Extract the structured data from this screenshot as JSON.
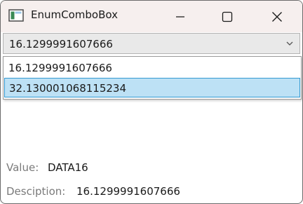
{
  "window": {
    "title": "EnumComboBox",
    "icon": "window-app-icon",
    "controls": [
      "minimize-icon",
      "maximize-icon",
      "close-icon"
    ]
  },
  "combo": {
    "selected_value": "16.1299991607666",
    "arrow_icon": "chevron-down-icon"
  },
  "dropdown": {
    "items": [
      {
        "label": "16.1299991607666",
        "highlighted": false
      },
      {
        "label": "32.130001068115234",
        "highlighted": true
      }
    ],
    "highlight_color": "#bde1f5",
    "highlight_border": "#3399d1"
  },
  "details": {
    "value_label": "Value:",
    "value": "DATA16",
    "description_label": "Desciption:",
    "description": "16.1299991607666"
  }
}
